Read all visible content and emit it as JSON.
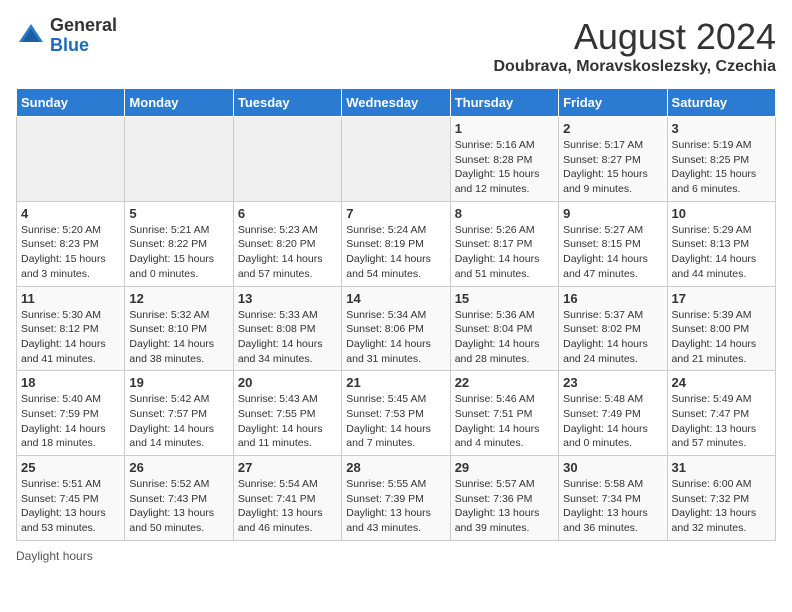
{
  "logo": {
    "general": "General",
    "blue": "Blue"
  },
  "title": "August 2024",
  "subtitle": "Doubrava, Moravskoslezsky, Czechia",
  "days_of_week": [
    "Sunday",
    "Monday",
    "Tuesday",
    "Wednesday",
    "Thursday",
    "Friday",
    "Saturday"
  ],
  "footer": "Daylight hours",
  "weeks": [
    [
      {
        "day": "",
        "info": ""
      },
      {
        "day": "",
        "info": ""
      },
      {
        "day": "",
        "info": ""
      },
      {
        "day": "",
        "info": ""
      },
      {
        "day": "1",
        "info": "Sunrise: 5:16 AM\nSunset: 8:28 PM\nDaylight: 15 hours and 12 minutes."
      },
      {
        "day": "2",
        "info": "Sunrise: 5:17 AM\nSunset: 8:27 PM\nDaylight: 15 hours and 9 minutes."
      },
      {
        "day": "3",
        "info": "Sunrise: 5:19 AM\nSunset: 8:25 PM\nDaylight: 15 hours and 6 minutes."
      }
    ],
    [
      {
        "day": "4",
        "info": "Sunrise: 5:20 AM\nSunset: 8:23 PM\nDaylight: 15 hours and 3 minutes."
      },
      {
        "day": "5",
        "info": "Sunrise: 5:21 AM\nSunset: 8:22 PM\nDaylight: 15 hours and 0 minutes."
      },
      {
        "day": "6",
        "info": "Sunrise: 5:23 AM\nSunset: 8:20 PM\nDaylight: 14 hours and 57 minutes."
      },
      {
        "day": "7",
        "info": "Sunrise: 5:24 AM\nSunset: 8:19 PM\nDaylight: 14 hours and 54 minutes."
      },
      {
        "day": "8",
        "info": "Sunrise: 5:26 AM\nSunset: 8:17 PM\nDaylight: 14 hours and 51 minutes."
      },
      {
        "day": "9",
        "info": "Sunrise: 5:27 AM\nSunset: 8:15 PM\nDaylight: 14 hours and 47 minutes."
      },
      {
        "day": "10",
        "info": "Sunrise: 5:29 AM\nSunset: 8:13 PM\nDaylight: 14 hours and 44 minutes."
      }
    ],
    [
      {
        "day": "11",
        "info": "Sunrise: 5:30 AM\nSunset: 8:12 PM\nDaylight: 14 hours and 41 minutes."
      },
      {
        "day": "12",
        "info": "Sunrise: 5:32 AM\nSunset: 8:10 PM\nDaylight: 14 hours and 38 minutes."
      },
      {
        "day": "13",
        "info": "Sunrise: 5:33 AM\nSunset: 8:08 PM\nDaylight: 14 hours and 34 minutes."
      },
      {
        "day": "14",
        "info": "Sunrise: 5:34 AM\nSunset: 8:06 PM\nDaylight: 14 hours and 31 minutes."
      },
      {
        "day": "15",
        "info": "Sunrise: 5:36 AM\nSunset: 8:04 PM\nDaylight: 14 hours and 28 minutes."
      },
      {
        "day": "16",
        "info": "Sunrise: 5:37 AM\nSunset: 8:02 PM\nDaylight: 14 hours and 24 minutes."
      },
      {
        "day": "17",
        "info": "Sunrise: 5:39 AM\nSunset: 8:00 PM\nDaylight: 14 hours and 21 minutes."
      }
    ],
    [
      {
        "day": "18",
        "info": "Sunrise: 5:40 AM\nSunset: 7:59 PM\nDaylight: 14 hours and 18 minutes."
      },
      {
        "day": "19",
        "info": "Sunrise: 5:42 AM\nSunset: 7:57 PM\nDaylight: 14 hours and 14 minutes."
      },
      {
        "day": "20",
        "info": "Sunrise: 5:43 AM\nSunset: 7:55 PM\nDaylight: 14 hours and 11 minutes."
      },
      {
        "day": "21",
        "info": "Sunrise: 5:45 AM\nSunset: 7:53 PM\nDaylight: 14 hours and 7 minutes."
      },
      {
        "day": "22",
        "info": "Sunrise: 5:46 AM\nSunset: 7:51 PM\nDaylight: 14 hours and 4 minutes."
      },
      {
        "day": "23",
        "info": "Sunrise: 5:48 AM\nSunset: 7:49 PM\nDaylight: 14 hours and 0 minutes."
      },
      {
        "day": "24",
        "info": "Sunrise: 5:49 AM\nSunset: 7:47 PM\nDaylight: 13 hours and 57 minutes."
      }
    ],
    [
      {
        "day": "25",
        "info": "Sunrise: 5:51 AM\nSunset: 7:45 PM\nDaylight: 13 hours and 53 minutes."
      },
      {
        "day": "26",
        "info": "Sunrise: 5:52 AM\nSunset: 7:43 PM\nDaylight: 13 hours and 50 minutes."
      },
      {
        "day": "27",
        "info": "Sunrise: 5:54 AM\nSunset: 7:41 PM\nDaylight: 13 hours and 46 minutes."
      },
      {
        "day": "28",
        "info": "Sunrise: 5:55 AM\nSunset: 7:39 PM\nDaylight: 13 hours and 43 minutes."
      },
      {
        "day": "29",
        "info": "Sunrise: 5:57 AM\nSunset: 7:36 PM\nDaylight: 13 hours and 39 minutes."
      },
      {
        "day": "30",
        "info": "Sunrise: 5:58 AM\nSunset: 7:34 PM\nDaylight: 13 hours and 36 minutes."
      },
      {
        "day": "31",
        "info": "Sunrise: 6:00 AM\nSunset: 7:32 PM\nDaylight: 13 hours and 32 minutes."
      }
    ]
  ]
}
